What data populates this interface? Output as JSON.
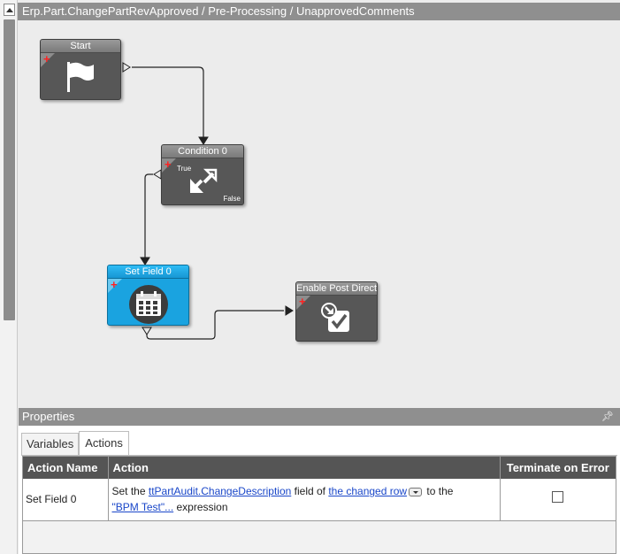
{
  "title": "Erp.Part.ChangePartRevApproved / Pre-Processing / UnapprovedComments",
  "nodes": {
    "start": {
      "label": "Start",
      "icon": "flag-icon"
    },
    "condition": {
      "label": "Condition 0",
      "true_label": "True",
      "false_label": "False",
      "icon": "condition-arrows-icon"
    },
    "setfield": {
      "label": "Set Field 0",
      "icon": "calendar-icon",
      "selected_color": "#1aa3e0"
    },
    "enablepost": {
      "label": "Enable Post Directi",
      "icon": "post-directive-icon"
    }
  },
  "properties": {
    "title": "Properties",
    "tabs": [
      {
        "label": "Variables"
      },
      {
        "label": "Actions"
      }
    ],
    "active_tab": "Actions",
    "columns": {
      "action_name": "Action Name",
      "action": "Action",
      "terminate": "Terminate on Error"
    },
    "row": {
      "action_name": "Set Field 0",
      "text_set_the": "Set the",
      "field_link": "ttPartAudit.ChangeDescription",
      "text_field_of": "field of",
      "row_link": "the changed row",
      "text_to_the": "to the",
      "expr_link": "\"BPM Test\"...",
      "text_expression": "expression",
      "terminate_checked": false
    }
  }
}
